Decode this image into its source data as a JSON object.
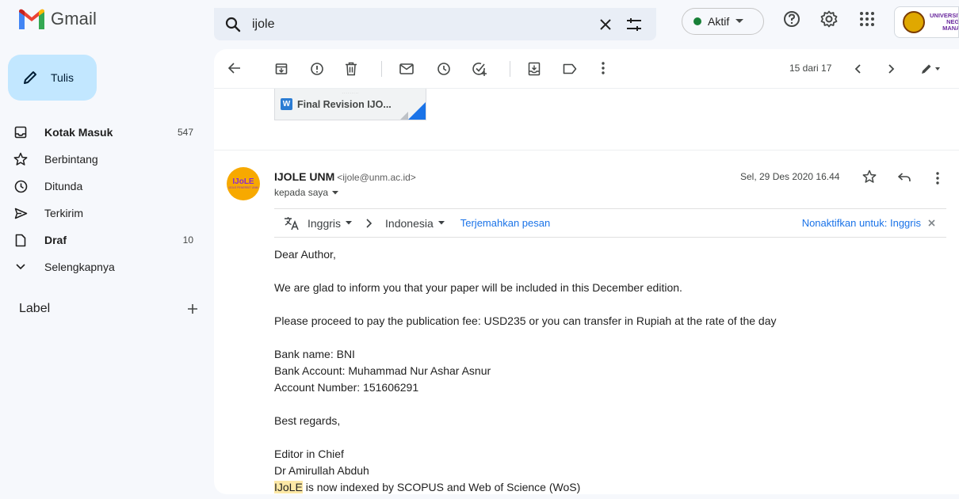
{
  "app": {
    "name": "Gmail"
  },
  "search": {
    "query": "ijole"
  },
  "status": {
    "label": "Aktif",
    "color": "#188038"
  },
  "org_badge": {
    "lines": [
      "UNIVERSITAS",
      "NEGERI",
      "MANADO"
    ]
  },
  "compose": {
    "label": "Tulis"
  },
  "sidebar": {
    "items": [
      {
        "label": "Kotak Masuk",
        "count": "547",
        "icon": "inbox-icon",
        "bold": true
      },
      {
        "label": "Berbintang",
        "count": "",
        "icon": "star-icon",
        "bold": false
      },
      {
        "label": "Ditunda",
        "count": "",
        "icon": "clock-icon",
        "bold": false
      },
      {
        "label": "Terkirim",
        "count": "",
        "icon": "send-icon",
        "bold": false
      },
      {
        "label": "Draf",
        "count": "10",
        "icon": "draft-icon",
        "bold": true
      },
      {
        "label": "Selengkapnya",
        "count": "",
        "icon": "chevron-down-icon",
        "bold": false
      }
    ],
    "label_section": "Label"
  },
  "toolbar": {
    "pager": "15 dari 17"
  },
  "previous_message": {
    "attachment_name": "Final Revision IJO...",
    "attachment_type": "W"
  },
  "message": {
    "avatar": {
      "main": "IJoLE",
      "sub": "IJOLE PENERBIT UNM"
    },
    "sender_name": "IJOLE UNM",
    "sender_email": "<ijole@unm.ac.id>",
    "to": "kepada saya",
    "date": "Sel, 29 Des 2020 16.44",
    "translate": {
      "from_lang": "Inggris",
      "to_lang": "Indonesia",
      "translate_link": "Terjemahkan pesan",
      "disable_link": "Nonaktifkan untuk: Inggris"
    },
    "body": {
      "greeting": "Dear Author,",
      "p1": "We are glad to inform you that your paper will be included in this December edition.",
      "p2": "Please proceed to pay the publication fee: USD235 or you can transfer in Rupiah at the rate of the day",
      "bank_name": "Bank name: BNI",
      "bank_account": "Bank Account: Muhammad Nur Ashar Asnur",
      "account_number": "Account Number: 151606291",
      "regards": "Best regards,",
      "sig_title": "Editor in Chief",
      "sig_name": "Dr Amirullah Abduh",
      "footer_highlight": "IJoLE",
      "footer_rest": " is now indexed by SCOPUS and Web of Science (WoS)"
    }
  }
}
